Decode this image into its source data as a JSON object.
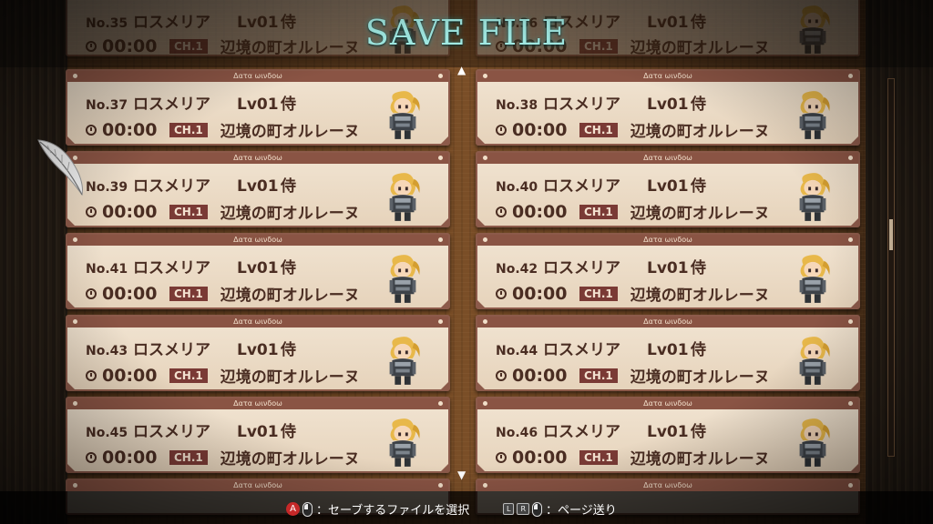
{
  "screen": {
    "title": "SAVE FILE"
  },
  "top_partial": [
    {
      "no": "No.35",
      "name": "ロスメリア",
      "level": "Lv01",
      "job": "侍",
      "time": "00:00",
      "chapter": "CH.1",
      "location": "辺境の町オルレーヌ"
    },
    {
      "no": "No.36",
      "name": "ロスメリア",
      "level": "Lv01",
      "job": "侍",
      "time": "00:00",
      "chapter": "CH.1",
      "location": "辺境の町オルレーヌ"
    }
  ],
  "slots": [
    {
      "header": "Δατα ωινδοω",
      "no": "No.37",
      "name": "ロスメリア",
      "level": "Lv01",
      "job": "侍",
      "time": "00:00",
      "chapter": "CH.1",
      "location": "辺境の町オルレーヌ"
    },
    {
      "header": "Δατα ωινδοω",
      "no": "No.38",
      "name": "ロスメリア",
      "level": "Lv01",
      "job": "侍",
      "time": "00:00",
      "chapter": "CH.1",
      "location": "辺境の町オルレーヌ"
    },
    {
      "header": "Δατα ωινδοω",
      "no": "No.39",
      "name": "ロスメリア",
      "level": "Lv01",
      "job": "侍",
      "time": "00:00",
      "chapter": "CH.1",
      "location": "辺境の町オルレーヌ"
    },
    {
      "header": "Δατα ωινδοω",
      "no": "No.40",
      "name": "ロスメリア",
      "level": "Lv01",
      "job": "侍",
      "time": "00:00",
      "chapter": "CH.1",
      "location": "辺境の町オルレーヌ"
    },
    {
      "header": "Δατα ωινδοω",
      "no": "No.41",
      "name": "ロスメリア",
      "level": "Lv01",
      "job": "侍",
      "time": "00:00",
      "chapter": "CH.1",
      "location": "辺境の町オルレーヌ"
    },
    {
      "header": "Δατα ωινδοω",
      "no": "No.42",
      "name": "ロスメリア",
      "level": "Lv01",
      "job": "侍",
      "time": "00:00",
      "chapter": "CH.1",
      "location": "辺境の町オルレーヌ"
    },
    {
      "header": "Δατα ωινδοω",
      "no": "No.43",
      "name": "ロスメリア",
      "level": "Lv01",
      "job": "侍",
      "time": "00:00",
      "chapter": "CH.1",
      "location": "辺境の町オルレーヌ"
    },
    {
      "header": "Δατα ωινδοω",
      "no": "No.44",
      "name": "ロスメリア",
      "level": "Lv01",
      "job": "侍",
      "time": "00:00",
      "chapter": "CH.1",
      "location": "辺境の町オルレーヌ"
    },
    {
      "header": "Δατα ωινδοω",
      "no": "No.45",
      "name": "ロスメリア",
      "level": "Lv01",
      "job": "侍",
      "time": "00:00",
      "chapter": "CH.1",
      "location": "辺境の町オルレーヌ"
    },
    {
      "header": "Δατα ωινδοω",
      "no": "No.46",
      "name": "ロスメリア",
      "level": "Lv01",
      "job": "侍",
      "time": "00:00",
      "chapter": "CH.1",
      "location": "辺境の町オルレーヌ"
    }
  ],
  "bottom_partial": [
    {
      "header": "Δατα ωινδοω"
    },
    {
      "header": "Δατα ωινδοω"
    }
  ],
  "scroll_arrows": {
    "up": "▲",
    "down": "▼"
  },
  "footer": {
    "select_button": "A",
    "select_label": "：セーブするファイルを選択",
    "key_l": "L",
    "key_r": "R",
    "page_label": "：ページ送り"
  },
  "icons": {
    "cursor": "feather-quill-icon",
    "time": "clock-icon",
    "portrait": "samurai-character-portrait-icon"
  },
  "colors": {
    "title": "#a9f5ee",
    "card_bg": "#f1e4d2",
    "card_border": "#8c5a4a",
    "chapter_badge": "#7a3a35",
    "text": "#4a2d22"
  }
}
